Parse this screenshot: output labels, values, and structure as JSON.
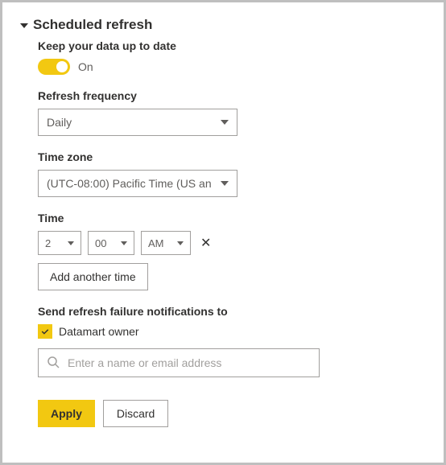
{
  "section": {
    "title": "Scheduled refresh"
  },
  "keep": {
    "label": "Keep your data up to date",
    "state": "On"
  },
  "frequency": {
    "label": "Refresh frequency",
    "value": "Daily"
  },
  "timezone": {
    "label": "Time zone",
    "value": "(UTC-08:00) Pacific Time (US an"
  },
  "time": {
    "label": "Time",
    "hour": "2",
    "minute": "00",
    "ampm": "AM",
    "addAnother": "Add another time"
  },
  "notify": {
    "label": "Send refresh failure notifications to",
    "ownerLabel": "Datamart owner",
    "placeholder": "Enter a name or email address"
  },
  "actions": {
    "apply": "Apply",
    "discard": "Discard"
  }
}
